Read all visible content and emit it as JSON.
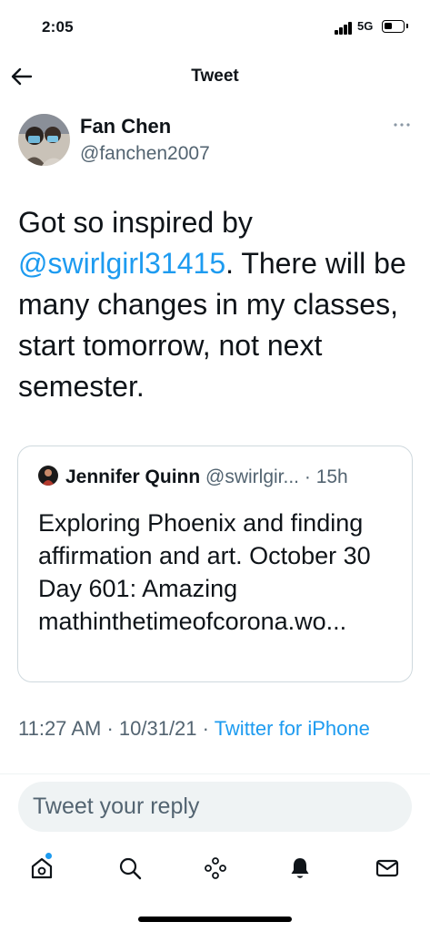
{
  "status_bar": {
    "time": "2:05",
    "network": "5G",
    "battery_level": 0.3
  },
  "header": {
    "title": "Tweet",
    "back_icon": "arrow-left-icon"
  },
  "tweet": {
    "author_name": "Fan Chen",
    "author_handle": "@fanchen2007",
    "text_before_mention": "Got so inspired by ",
    "mention": "@swirlgirl31415",
    "text_after_mention": ". There will be many changes in my classes, start tomorrow, not next semester.",
    "more_icon": "more-horizontal-icon"
  },
  "quoted_tweet": {
    "author_name": "Jennifer Quinn",
    "author_handle": "@swirlgir...",
    "time_ago": "· 15h",
    "text": "Exploring Phoenix and finding affirmation and art. October 30 Day 601: Amazing mathinthetimeofcorona.wo..."
  },
  "meta": {
    "time": "11:27 AM",
    "date": "10/31/21",
    "source": "Twitter for iPhone"
  },
  "reply": {
    "placeholder": "Tweet your reply"
  },
  "tab_bar": [
    {
      "icon": "home-icon",
      "active": true
    },
    {
      "icon": "search-icon"
    },
    {
      "icon": "spaces-icon"
    },
    {
      "icon": "bell-icon"
    },
    {
      "icon": "mail-icon"
    }
  ],
  "colors": {
    "accent": "#1d9bf0",
    "secondary_text": "#536471",
    "border": "#cfd9de"
  }
}
